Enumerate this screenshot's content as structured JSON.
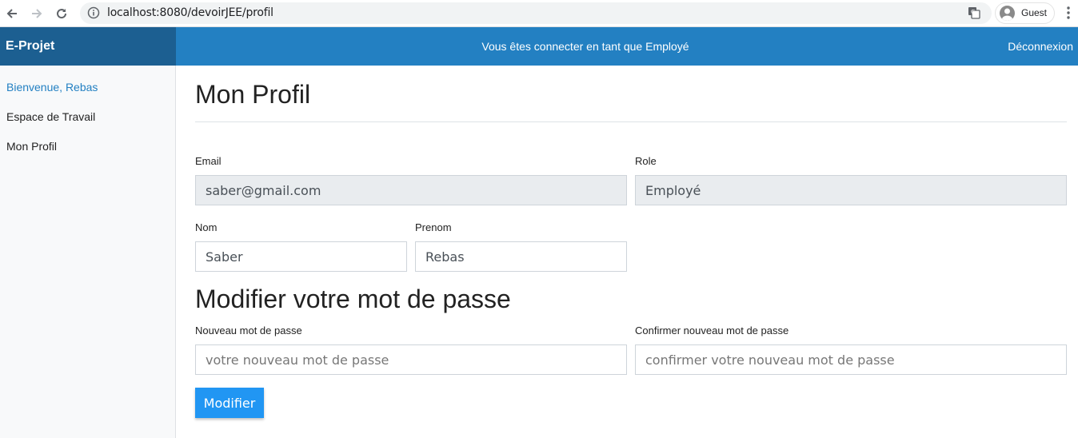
{
  "browser": {
    "url": "localhost:8080/devoirJEE/profil",
    "profile_label": "Guest"
  },
  "app": {
    "brand": "E-Projet",
    "status_text": "Vous êtes connecter en tant que Employé",
    "logout_label": "Déconnexion"
  },
  "sidebar": {
    "items": [
      {
        "label": "Bienvenue, Rebas",
        "active": true
      },
      {
        "label": "Espace de Travail",
        "active": false
      },
      {
        "label": "Mon Profil",
        "active": false
      }
    ]
  },
  "profile": {
    "title": "Mon Profil",
    "email_label": "Email",
    "email_value": "saber@gmail.com",
    "role_label": "Role",
    "role_value": "Employé",
    "nom_label": "Nom",
    "nom_value": "Saber",
    "prenom_label": "Prenom",
    "prenom_value": "Rebas"
  },
  "password": {
    "title": "Modifier votre mot de passe",
    "new_label": "Nouveau mot de passe",
    "new_placeholder": "votre nouveau mot de passe",
    "confirm_label": "Confirmer nouveau mot de passe",
    "confirm_placeholder": "confirmer votre nouveau mot de passe",
    "submit_label": "Modifier"
  },
  "colors": {
    "brand_bg": "#1c5f91",
    "topbar_bg": "#2380c2",
    "button_bg": "#2196f3",
    "active_link": "#2380c2"
  }
}
